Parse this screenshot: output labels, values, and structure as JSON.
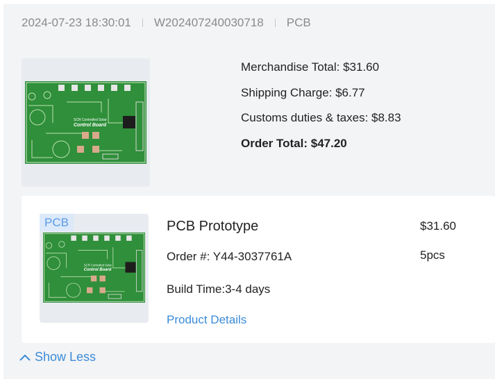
{
  "header": {
    "datetime": "2024-07-23 18:30:01",
    "order_id": "W202407240030718",
    "category": "PCB"
  },
  "summary": {
    "image": {
      "label": "PCB board preview",
      "board_title": "Control Board"
    },
    "merchandise_total": "Merchandise Total: $31.60",
    "shipping_charge": "Shipping Charge: $6.77",
    "customs": "Customs duties & taxes: $8.83",
    "order_total": "Order Total: $47.20"
  },
  "product": {
    "badge": "PCB",
    "title": "PCB Prototype",
    "order_number": "Order #: Y44-3037761A",
    "build_time": "Build Time:3-4 days",
    "details_link": "Product Details",
    "price": "$31.60",
    "quantity": "5pcs",
    "image": {
      "board_title": "Control Board"
    }
  },
  "footer": {
    "show_less": "Show Less",
    "icon": "chevron-up-icon"
  },
  "colors": {
    "background": "#f3f4f6",
    "card": "#ffffff",
    "link": "#3b8bd8",
    "badge_bg": "#dbe9fa",
    "pcb_green": "#2f8f3a"
  }
}
